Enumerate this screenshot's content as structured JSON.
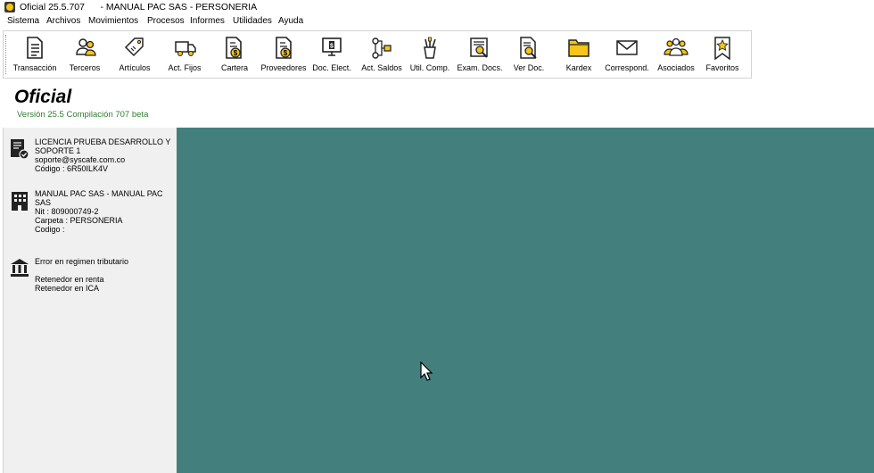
{
  "window": {
    "title": "Oficial 25.5.707      - MANUAL PAC SAS - PERSONERIA"
  },
  "menu": [
    "Sistema",
    "Archivos",
    "Movimientos",
    "Procesos",
    "Informes",
    "Utilidades",
    "Ayuda"
  ],
  "toolbar": [
    {
      "label": "Transacción",
      "icon": "document-icon"
    },
    {
      "label": "Terceros",
      "icon": "people-icon"
    },
    {
      "label": "Artículos",
      "icon": "tag-icon"
    },
    {
      "label": "Act. Fijos",
      "icon": "truck-icon"
    },
    {
      "label": "Cartera",
      "icon": "document-money-icon"
    },
    {
      "label": "Proveedores",
      "icon": "document-money-icon"
    },
    {
      "label": "Doc. Elect.",
      "icon": "monitor-money-icon"
    },
    {
      "label": "Act. Saldos",
      "icon": "flow-icon"
    },
    {
      "label": "Util. Comp.",
      "icon": "pencil-cup-icon"
    },
    {
      "label": "Exam. Docs.",
      "icon": "magnifier-document-icon"
    },
    {
      "label": "Ver Doc.",
      "icon": "search-document-icon"
    },
    {
      "label": "Kardex",
      "icon": "folder-icon"
    },
    {
      "label": "Correspond.",
      "icon": "envelope-icon"
    },
    {
      "label": "Asociados",
      "icon": "group-icon"
    },
    {
      "label": "Favoritos",
      "icon": "star-bookmark-icon"
    }
  ],
  "header": {
    "brand": "Oficial",
    "version": "Versión 25.5 Compilación 707 beta"
  },
  "sidebar": {
    "license": {
      "line1": "LICENCIA PRUEBA DESARROLLO Y",
      "line2": "SOPORTE 1",
      "email": "soporte@syscafe.com.co",
      "code": "Código : 6R50ILK4V"
    },
    "company": {
      "name": "MANUAL PAC SAS - MANUAL PAC SAS",
      "nit": "Nit : 809000749-2",
      "folder": "Carpeta : PERSONERIA",
      "code": "Codigo :"
    },
    "tax": {
      "error": "Error en regimen tributario",
      "retainer_income": "Retenedor en renta",
      "retainer_ica": "Retenedor en ICA"
    }
  },
  "colors": {
    "main_background": "#437f7c",
    "version_text": "#2e7d2e",
    "icon_accent": "#f5c518"
  }
}
